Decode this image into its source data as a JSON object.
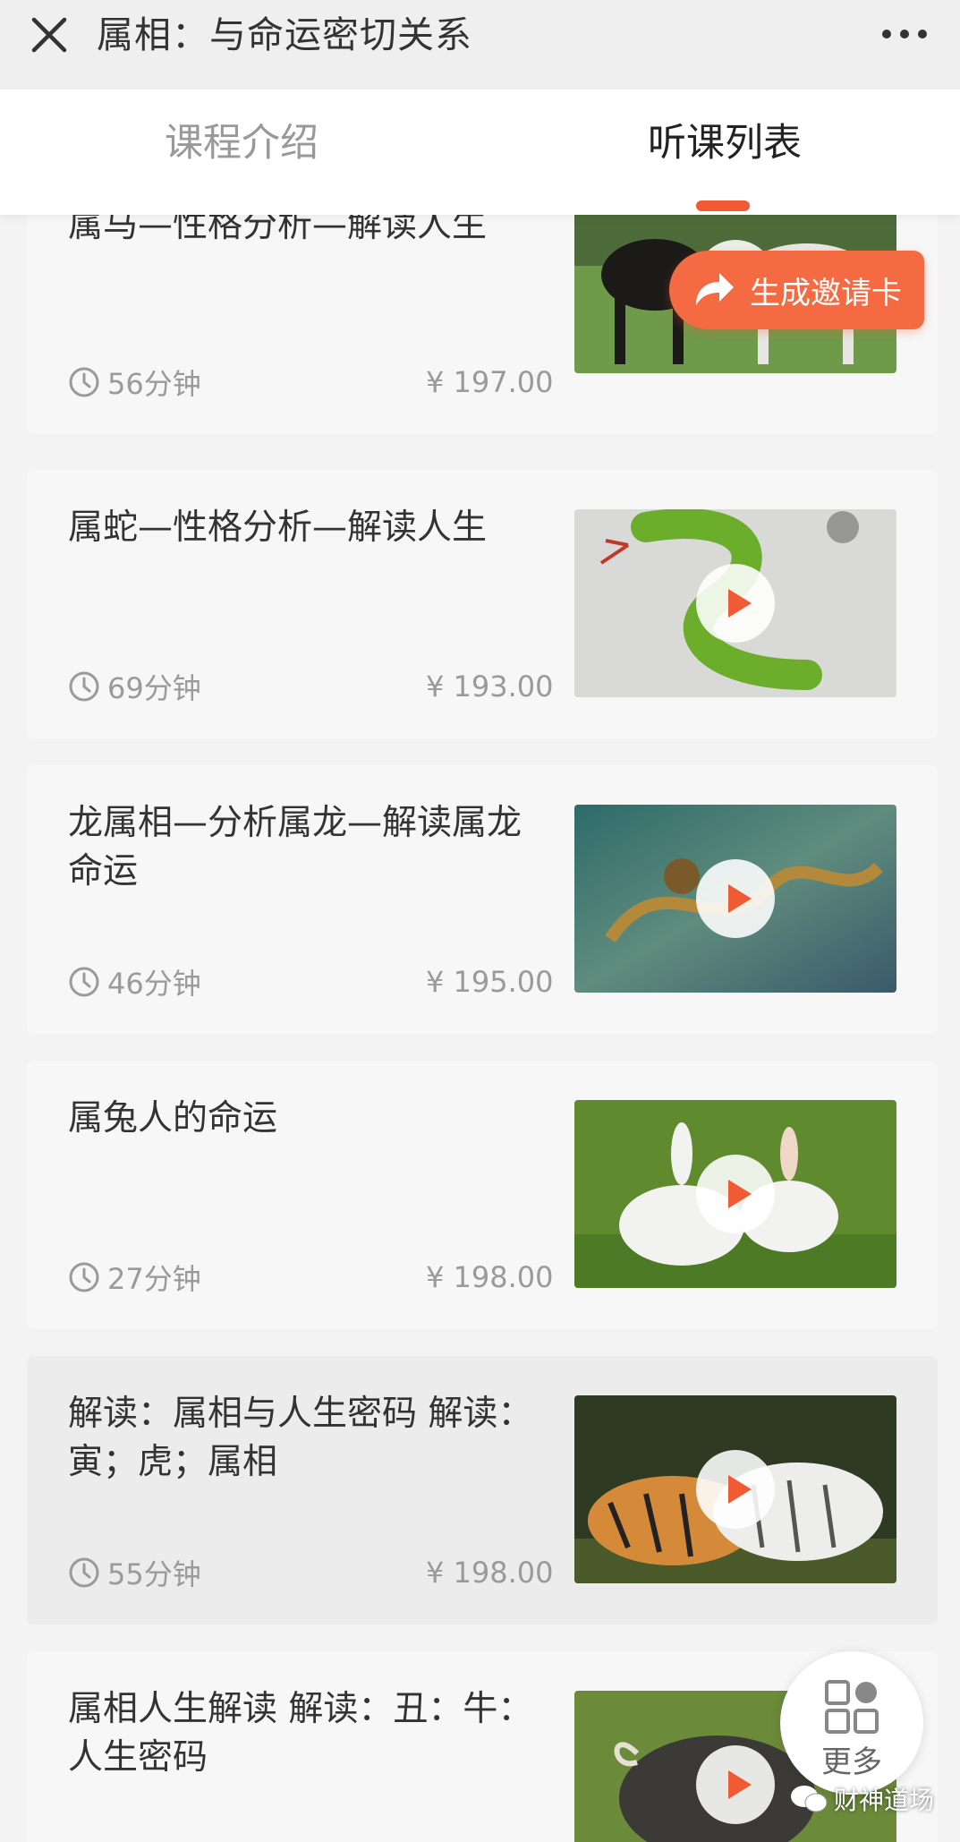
{
  "header": {
    "title": "属相：与命运密切关系",
    "close_icon": "close-icon",
    "more_icon": "more-dots-icon"
  },
  "tabs": [
    {
      "label": "课程介绍",
      "active": false
    },
    {
      "label": "听课列表",
      "active": true
    }
  ],
  "accent_color": "#f05a34",
  "invite": {
    "label": "生成邀请卡",
    "icon": "share-arrow-icon"
  },
  "courses": [
    {
      "title": "属马—性格分析—解读人生",
      "duration": "56分钟",
      "price": "¥ 197.00",
      "thumb": "horses"
    },
    {
      "title": "属蛇—性格分析—解读人生",
      "duration": "69分钟",
      "price": "¥ 193.00",
      "thumb": "snake"
    },
    {
      "title": "龙属相—分析属龙—解读属龙命运",
      "duration": "46分钟",
      "price": "¥ 195.00",
      "thumb": "dragon"
    },
    {
      "title": "属兔人的命运",
      "duration": "27分钟",
      "price": "¥ 198.00",
      "thumb": "rabbits"
    },
    {
      "title": "解读：属相与人生密码 解读：寅；虎；属相",
      "duration": "55分钟",
      "price": "¥ 198.00",
      "thumb": "tigers"
    },
    {
      "title": "属相人生解读 解读：丑：牛：人生密码",
      "duration": "",
      "price": "",
      "thumb": "ox"
    }
  ],
  "fab": {
    "label": "更多",
    "icon": "grid-apps-icon"
  },
  "watermark": {
    "label": "财神道场",
    "icon": "wechat-icon"
  }
}
